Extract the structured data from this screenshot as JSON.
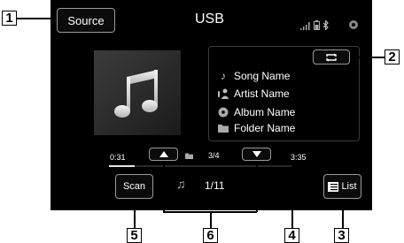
{
  "screen": {
    "source_label": "Source",
    "title": "USB",
    "track": {
      "song": "Song Name",
      "artist": "Artist Name",
      "album": "Album Name",
      "folder": "Folder Name"
    },
    "elapsed": "0:31",
    "duration": "3:35",
    "progress": 0.14,
    "folder_index": "3/4",
    "track_index": "1/11",
    "scan_label": "Scan",
    "list_label": "List"
  },
  "callouts": [
    "1",
    "2",
    "3",
    "4",
    "5",
    "6"
  ]
}
